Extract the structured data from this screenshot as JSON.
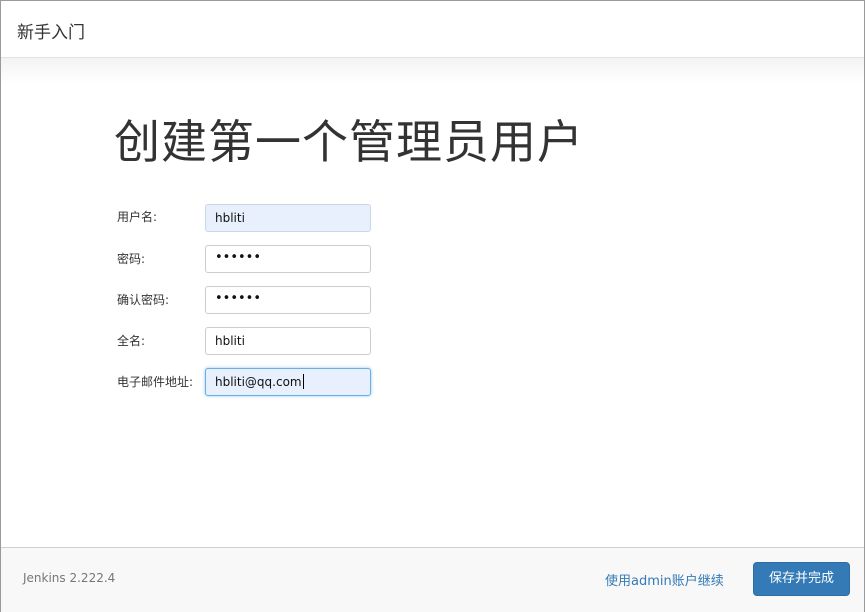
{
  "dialog": {
    "title": "新手入门"
  },
  "main": {
    "heading": "创建第一个管理员用户",
    "fields": [
      {
        "label": "用户名:",
        "value": "hbliti",
        "state": "autofilled"
      },
      {
        "label": "密码:",
        "value": "••••••",
        "state": "masked"
      },
      {
        "label": "确认密码:",
        "value": "••••••",
        "state": "masked"
      },
      {
        "label": "全名:",
        "value": "hbliti",
        "state": "normal"
      },
      {
        "label": "电子邮件地址:",
        "value": "hbliti@qq.com",
        "state": "focused"
      }
    ]
  },
  "footer": {
    "version": "Jenkins 2.222.4",
    "continue_as_admin": "使用admin账户继续",
    "save_and_finish": "保存并完成"
  },
  "colors": {
    "primary_button": "#337ab7",
    "link": "#337ab7",
    "autofill_background": "#e8f0fe",
    "focus_border": "#66afe9"
  }
}
